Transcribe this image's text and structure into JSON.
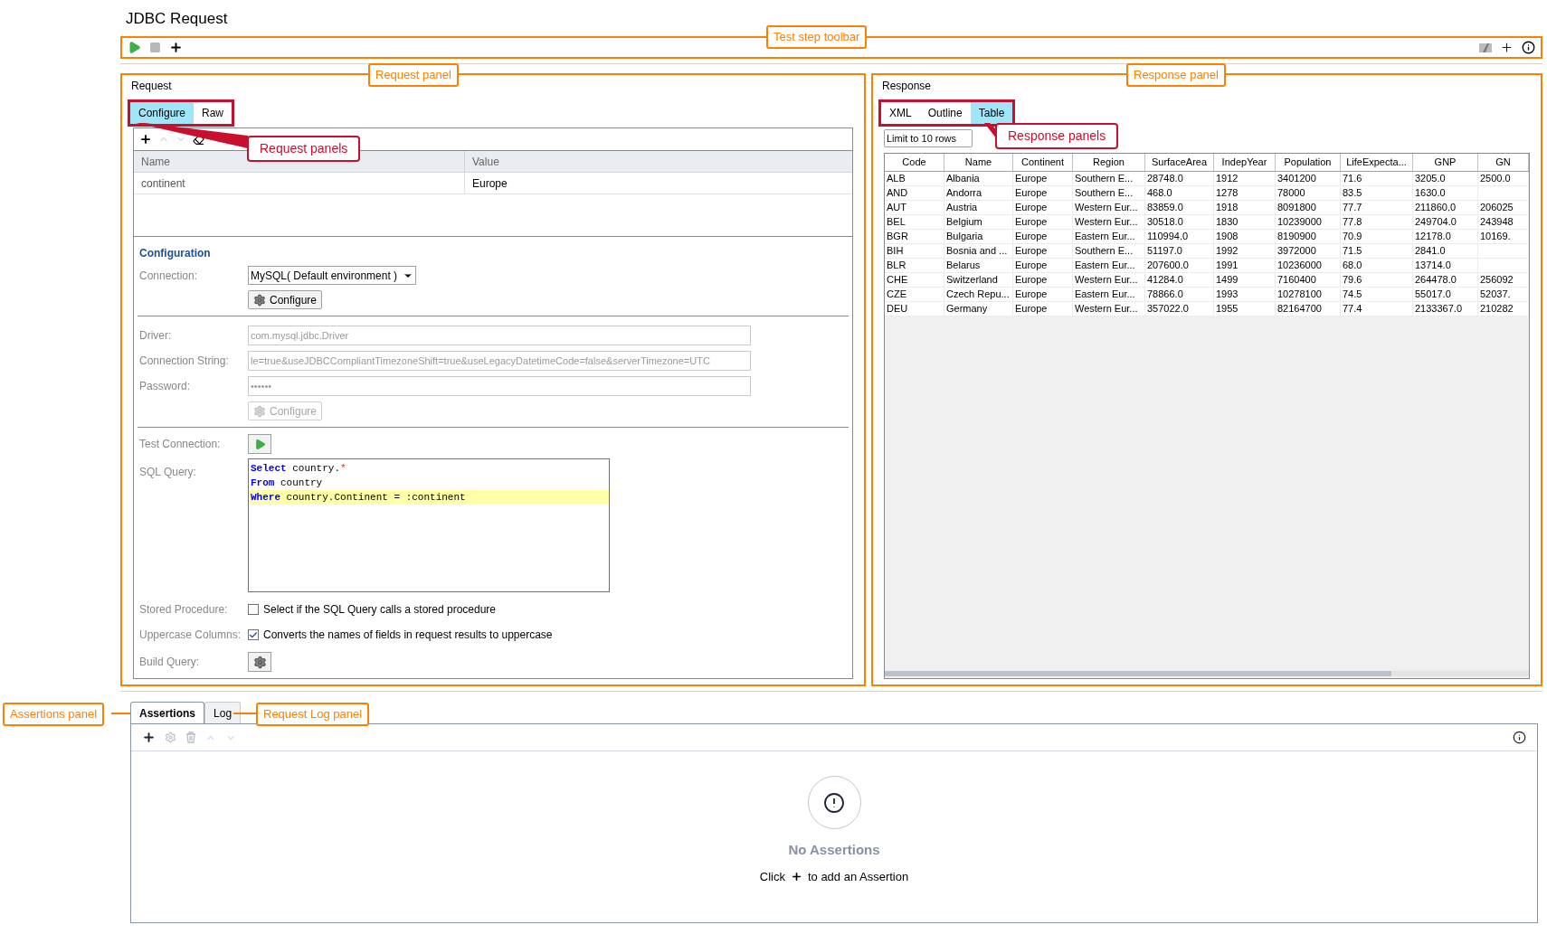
{
  "title": "JDBC Request",
  "toolbar": {
    "annotation": "Test step toolbar"
  },
  "request": {
    "heading": "Request",
    "annotation": "Request panel",
    "tabs_annotation": "Request panels",
    "tabs": [
      {
        "label": "Configure",
        "selected": true
      },
      {
        "label": "Raw",
        "selected": false
      }
    ],
    "params": {
      "columns": [
        "Name",
        "Value"
      ],
      "rows": [
        [
          "continent",
          "Europe"
        ]
      ]
    },
    "configuration": {
      "heading": "Configuration",
      "connection": {
        "label": "Connection:",
        "value": "MySQL( Default environment )"
      },
      "configure_button": {
        "label": "Configure",
        "disabled": false
      },
      "fields": [
        {
          "label": "Driver:",
          "value": "com.mysql.jdbc.Driver",
          "disabled": true
        },
        {
          "label": "Connection String:",
          "value": "le=true&useJDBCCompliantTimezoneShift=true&useLegacyDatetimeCode=false&serverTimezone=UTC",
          "disabled": true
        },
        {
          "label": "Password:",
          "value": "••••••",
          "disabled": true
        }
      ],
      "configure_button_2": {
        "label": "Configure",
        "disabled": true
      },
      "test_connection": {
        "label": "Test Connection:"
      },
      "sql_query": {
        "label": "SQL Query:",
        "lines": [
          {
            "highlighted": false,
            "tokens": [
              {
                "kind": "keyword",
                "text": "Select"
              },
              {
                "kind": "plain",
                "text": " country."
              },
              {
                "kind": "operator",
                "text": "*"
              }
            ]
          },
          {
            "highlighted": false,
            "tokens": [
              {
                "kind": "keyword",
                "text": "From"
              },
              {
                "kind": "plain",
                "text": " country"
              }
            ]
          },
          {
            "highlighted": true,
            "tokens": [
              {
                "kind": "keyword",
                "text": "Where"
              },
              {
                "kind": "plain",
                "text": " country.Continent = :continent"
              }
            ]
          }
        ]
      },
      "options": [
        {
          "label": "Stored Procedure:",
          "text": "Select if the SQL Query calls a stored procedure",
          "checked": false
        },
        {
          "label": "Uppercase Columns:",
          "text": "Converts the names of fields in request results to uppercase",
          "checked": true
        }
      ],
      "build_query": {
        "label": "Build Query:"
      }
    }
  },
  "response": {
    "heading": "Response",
    "annotation": "Response panel",
    "tabs_annotation": "Response panels",
    "tabs": [
      {
        "label": "XML",
        "selected": false
      },
      {
        "label": "Outline",
        "selected": false
      },
      {
        "label": "Table",
        "selected": true
      }
    ],
    "limit": "Limit to 10 rows",
    "table": {
      "columns": [
        "Code",
        "Name",
        "Continent",
        "Region",
        "SurfaceArea",
        "IndepYear",
        "Population",
        "LifeExpecta...",
        "GNP",
        "GN"
      ],
      "rows": [
        [
          "ALB",
          "Albania",
          "Europe",
          "Southern E...",
          "28748.0",
          "1912",
          "3401200",
          "71.6",
          "3205.0",
          "2500.0"
        ],
        [
          "AND",
          "Andorra",
          "Europe",
          "Southern E...",
          "468.0",
          "1278",
          "78000",
          "83.5",
          "1630.0",
          null
        ],
        [
          "AUT",
          "Austria",
          "Europe",
          "Western Eur...",
          "83859.0",
          "1918",
          "8091800",
          "77.7",
          "211860.0",
          "206025"
        ],
        [
          "BEL",
          "Belgium",
          "Europe",
          "Western Eur...",
          "30518.0",
          "1830",
          "10239000",
          "77.8",
          "249704.0",
          "243948"
        ],
        [
          "BGR",
          "Bulgaria",
          "Europe",
          "Eastern Eur...",
          "110994.0",
          "1908",
          "8190900",
          "70.9",
          "12178.0",
          "10169."
        ],
        [
          "BIH",
          "Bosnia and ...",
          "Europe",
          "Southern E...",
          "51197.0",
          "1992",
          "3972000",
          "71.5",
          "2841.0",
          null
        ],
        [
          "BLR",
          "Belarus",
          "Europe",
          "Eastern Eur...",
          "207600.0",
          "1991",
          "10236000",
          "68.0",
          "13714.0",
          null
        ],
        [
          "CHE",
          "Switzerland",
          "Europe",
          "Western Eur...",
          "41284.0",
          "1499",
          "7160400",
          "79.6",
          "264478.0",
          "256092"
        ],
        [
          "CZE",
          "Czech Repu...",
          "Europe",
          "Eastern Eur...",
          "78866.0",
          "1993",
          "10278100",
          "74.5",
          "55017.0",
          "52037."
        ],
        [
          "DEU",
          "Germany",
          "Europe",
          "Western Eur...",
          "357022.0",
          "1955",
          "82164700",
          "77.4",
          "2133367.0",
          "210282"
        ]
      ]
    }
  },
  "assertions": {
    "annotation": "Assertions panel",
    "log_annotation": "Request Log panel",
    "tabs": [
      {
        "label": "Assertions",
        "selected": true
      },
      {
        "label": "Log",
        "selected": false
      }
    ],
    "empty_title": "No Assertions",
    "hint_before": "Click",
    "hint_after": "to add an Assertion"
  }
}
